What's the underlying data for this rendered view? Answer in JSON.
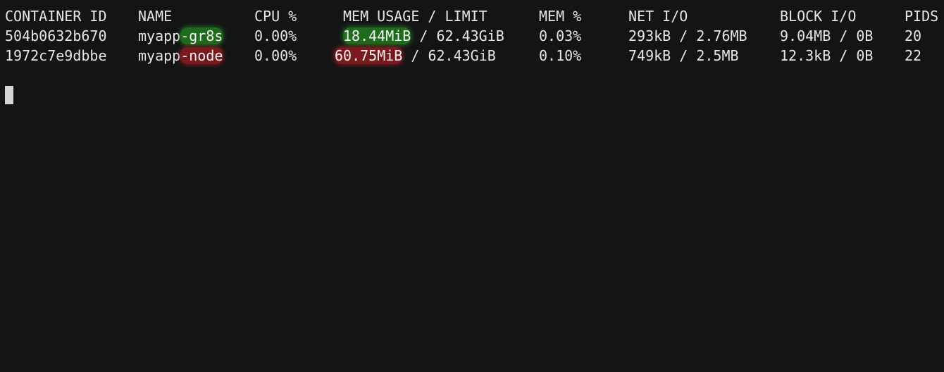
{
  "terminal": {
    "header": {
      "container_id": "CONTAINER ID",
      "name": "NAME",
      "cpu": "CPU %",
      "mem_usage": "MEM USAGE / LIMIT",
      "mem_pct": "MEM %",
      "net_io": "NET I/O",
      "block_io": "BLOCK I/O",
      "pids": "PIDS"
    },
    "rows": [
      {
        "container_id": "504b0632b670",
        "name_prefix": "myapp",
        "name_suffix": "-gr8s",
        "cpu": "0.00%",
        "mem_usage": "18.44MiB",
        "mem_limit": " / 62.43GiB",
        "mem_pct": "0.03%",
        "net_io": "293kB / 2.76MB",
        "block_io": "9.04MB / 0B",
        "pids": "20",
        "highlight_color": "#1e6b1b"
      },
      {
        "container_id": "1972c7e9dbbe",
        "name_prefix": "myapp",
        "name_suffix": "-node",
        "cpu": "0.00%",
        "mem_usage": "60.75MiB",
        "mem_limit": " / 62.43GiB",
        "mem_pct": "0.10%",
        "net_io": "749kB / 2.5MB",
        "block_io": "12.3kB / 0B",
        "pids": "22",
        "highlight_color": "#7a1a1f"
      }
    ],
    "colors": {
      "background": "#131416",
      "foreground": "#e6e6e6",
      "green_highlight": "#1e6b1b",
      "red_highlight": "#7a1a1f"
    }
  }
}
